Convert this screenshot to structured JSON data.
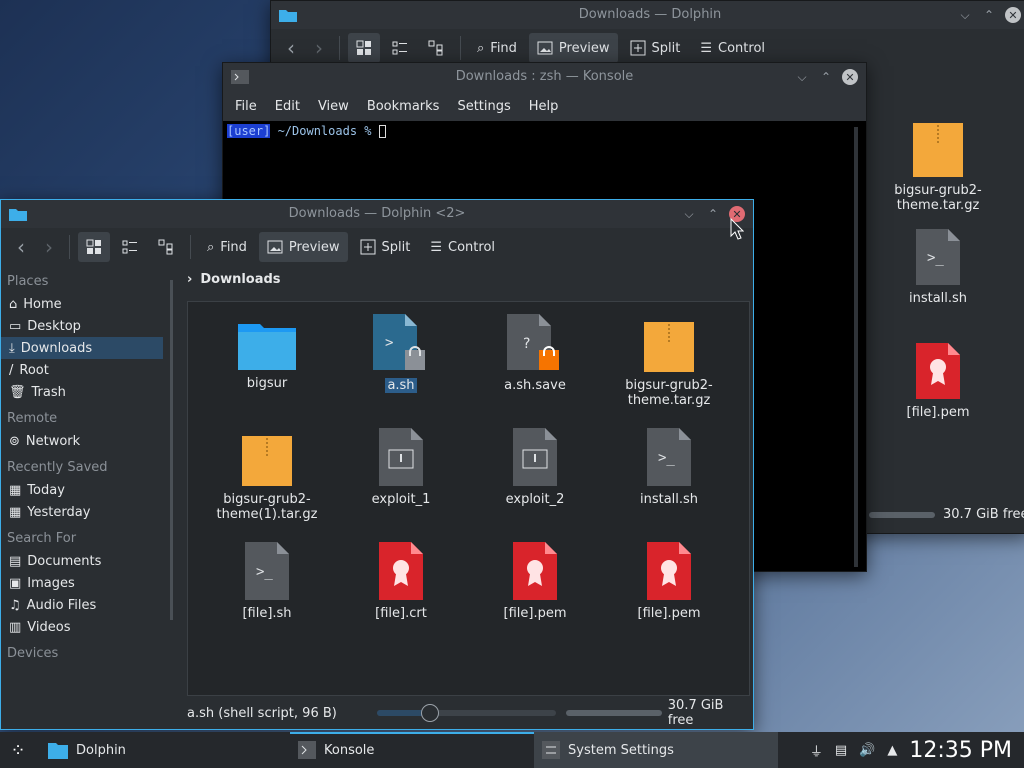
{
  "back_dolphin": {
    "title": "Downloads — Dolphin",
    "toolbar": {
      "find": "Find",
      "preview": "Preview",
      "split": "Split",
      "control": "Control"
    },
    "files": [
      {
        "name": "bigsur-grub2-theme.tar.gz",
        "icon": "archive-icon"
      },
      {
        "name": "install.sh",
        "icon": "script-icon"
      },
      {
        "name": "[file].pem",
        "icon": "certificate-icon"
      }
    ],
    "free": "30.7 GiB free"
  },
  "konsole": {
    "title": "Downloads : zsh — Konsole",
    "menu": [
      "File",
      "Edit",
      "View",
      "Bookmarks",
      "Settings",
      "Help"
    ],
    "prompt_user": "[user]",
    "prompt_path": " ~/Downloads % "
  },
  "dolphin": {
    "title": "Downloads — Dolphin <2>",
    "toolbar": {
      "find": "Find",
      "preview": "Preview",
      "split": "Split",
      "control": "Control"
    },
    "breadcrumb": "Downloads",
    "sidebar": {
      "places_header": "Places",
      "places": [
        "Home",
        "Desktop",
        "Downloads",
        "Root",
        "Trash"
      ],
      "remote_header": "Remote",
      "remote": [
        "Network"
      ],
      "recent_header": "Recently Saved",
      "recent": [
        "Today",
        "Yesterday"
      ],
      "search_header": "Search For",
      "search": [
        "Documents",
        "Images",
        "Audio Files",
        "Videos"
      ],
      "devices_header": "Devices"
    },
    "files": [
      {
        "name": "bigsur",
        "icon": "folder-icon"
      },
      {
        "name": "a.sh",
        "icon": "script-icon"
      },
      {
        "name": "a.sh.save",
        "icon": "unknown-file-icon"
      },
      {
        "name": "bigsur-grub2-theme.tar.gz",
        "icon": "archive-icon"
      },
      {
        "name": "bigsur-grub2-theme(1).tar.gz",
        "icon": "archive-icon"
      },
      {
        "name": "exploit_1",
        "icon": "executable-icon"
      },
      {
        "name": "exploit_2",
        "icon": "executable-icon"
      },
      {
        "name": "install.sh",
        "icon": "script-icon"
      },
      {
        "name": "[file].sh",
        "icon": "script-icon"
      },
      {
        "name": "[file].crt",
        "icon": "certificate-icon"
      },
      {
        "name": "[file].pem",
        "icon": "certificate-icon"
      },
      {
        "name": "[file].pem",
        "icon": "certificate-icon"
      }
    ],
    "status": "a.sh (shell script, 96 B)",
    "zoom": 0.3,
    "free": "30.7 GiB free"
  },
  "taskbar": {
    "tasks": [
      "Dolphin",
      "Konsole",
      "System Settings"
    ],
    "clock": "12:35 PM"
  },
  "colors": {
    "accent": "#3daee9",
    "folder": "#3daee9",
    "archive": "#f3a83b",
    "cert": "#d9242b",
    "close_active": "#e06b73"
  }
}
